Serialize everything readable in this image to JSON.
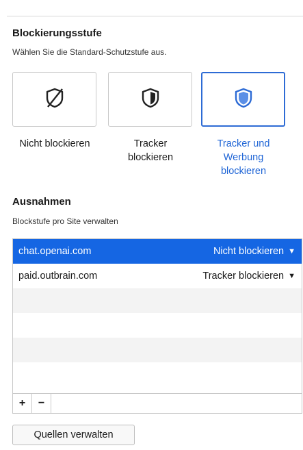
{
  "blocking": {
    "heading": "Blockierungsstufe",
    "description": "Wählen Sie die Standard-Schutzstufe aus.",
    "levels": [
      {
        "label": "Nicht blockieren",
        "icon": "shield-slash-icon"
      },
      {
        "label": "Tracker blockieren",
        "icon": "shield-half-icon"
      },
      {
        "label": "Tracker und Werbung blockieren",
        "icon": "shield-full-icon"
      }
    ],
    "accent_color": "#2d6bd5"
  },
  "exceptions": {
    "heading": "Ausnahmen",
    "description": "Blockstufe pro Site verwalten",
    "rows": [
      {
        "site": "chat.openai.com",
        "level": "Nicht blockieren"
      },
      {
        "site": "paid.outbrain.com",
        "level": "Tracker blockieren"
      }
    ],
    "add_label": "+",
    "remove_label": "−",
    "selected_color": "#1566e3"
  },
  "manage_button": "Quellen verwalten"
}
